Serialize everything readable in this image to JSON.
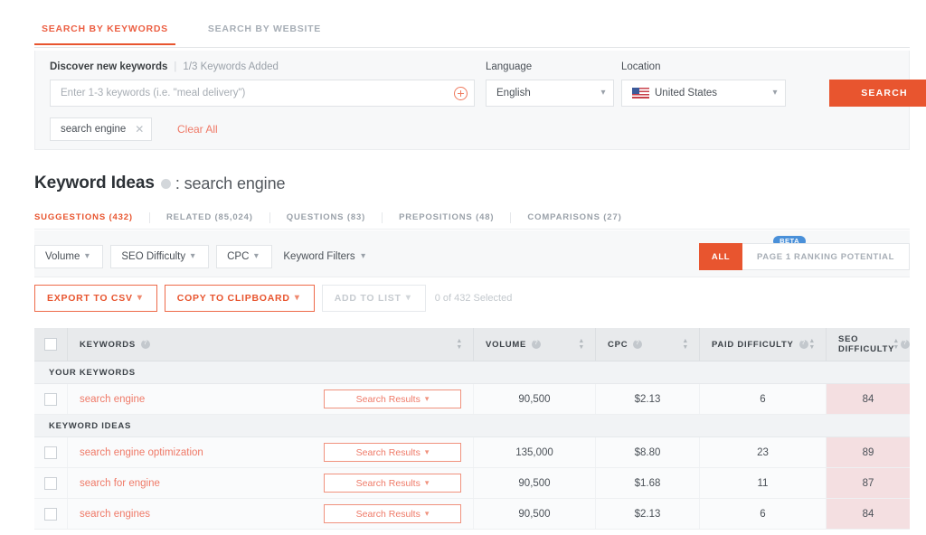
{
  "top_tabs": [
    {
      "label": "SEARCH BY KEYWORDS",
      "active": true
    },
    {
      "label": "SEARCH BY WEBSITE",
      "active": false
    }
  ],
  "search_panel": {
    "discover_label": "Discover new keywords",
    "separator": "|",
    "added_text": "1/3 Keywords Added",
    "keyword_input_placeholder": "Enter 1-3 keywords (i.e. \"meal delivery\")",
    "keyword_input_value": "",
    "add_icon": "plus-circle-icon",
    "language_label": "Language",
    "language_value": "English",
    "location_label": "Location",
    "location_value": "United States",
    "location_flag": "us-flag-icon",
    "search_button": "SEARCH",
    "chip_label": "search engine",
    "chip_remove_icon": "close-icon",
    "clear_all": "Clear All",
    "chevron_icon": "chevron-down-icon"
  },
  "heading": {
    "title": "Keyword Ideas",
    "info_icon": "info-icon",
    "query": ": search engine"
  },
  "sub_tabs": [
    {
      "label": "SUGGESTIONS (432)",
      "active": true
    },
    {
      "label": "RELATED (85,024)",
      "active": false
    },
    {
      "label": "QUESTIONS (83)",
      "active": false
    },
    {
      "label": "PREPOSITIONS (48)",
      "active": false
    },
    {
      "label": "COMPARISONS (27)",
      "active": false
    }
  ],
  "filters": [
    {
      "label": "Volume",
      "type": "pill"
    },
    {
      "label": "SEO Difficulty",
      "type": "pill"
    },
    {
      "label": "CPC",
      "type": "pill"
    },
    {
      "label": "Keyword Filters",
      "type": "plain"
    }
  ],
  "view_toggle": {
    "beta_badge": "BETA",
    "all_label": "ALL",
    "page1_label": "PAGE 1 RANKING POTENTIAL",
    "active": "ALL"
  },
  "actions": {
    "export_csv": "EXPORT TO CSV",
    "copy_clipboard": "COPY TO CLIPBOARD",
    "add_to_list": "ADD TO LIST",
    "add_to_list_disabled": true,
    "selected_count": "0 of 432 Selected"
  },
  "table": {
    "columns": [
      {
        "label": "KEYWORDS",
        "info": true,
        "sortable": true
      },
      {
        "label": "VOLUME",
        "info": true,
        "sortable": true
      },
      {
        "label": "CPC",
        "info": true,
        "sortable": true
      },
      {
        "label": "PAID DIFFICULTY",
        "info": true,
        "sortable": true
      },
      {
        "label": "SEO DIFFICULTY",
        "info": true,
        "sortable": true
      }
    ],
    "header_checkbox_checked": false,
    "groups": [
      {
        "title": "YOUR KEYWORDS",
        "rows": [
          {
            "keyword": "search engine",
            "search_results_label": "Search Results",
            "volume": "90,500",
            "cpc": "$2.13",
            "paid_difficulty": "6",
            "seo_difficulty": "84",
            "checked": false
          }
        ]
      },
      {
        "title": "KEYWORD IDEAS",
        "rows": [
          {
            "keyword": "search engine optimization",
            "search_results_label": "Search Results",
            "volume": "135,000",
            "cpc": "$8.80",
            "paid_difficulty": "23",
            "seo_difficulty": "89",
            "checked": false
          },
          {
            "keyword": "search for engine",
            "search_results_label": "Search Results",
            "volume": "90,500",
            "cpc": "$1.68",
            "paid_difficulty": "11",
            "seo_difficulty": "87",
            "checked": false
          },
          {
            "keyword": "search engines",
            "search_results_label": "Search Results",
            "volume": "90,500",
            "cpc": "$2.13",
            "paid_difficulty": "6",
            "seo_difficulty": "84",
            "checked": false
          }
        ]
      }
    ]
  },
  "colors": {
    "accent_orange": "#e8552f",
    "link_coral": "#ef7a68",
    "beta_blue": "#4a90d9",
    "seo_cell_pink": "#f4dfe1",
    "header_gray": "#e8eaec",
    "panel_gray": "#f7f8f9"
  }
}
